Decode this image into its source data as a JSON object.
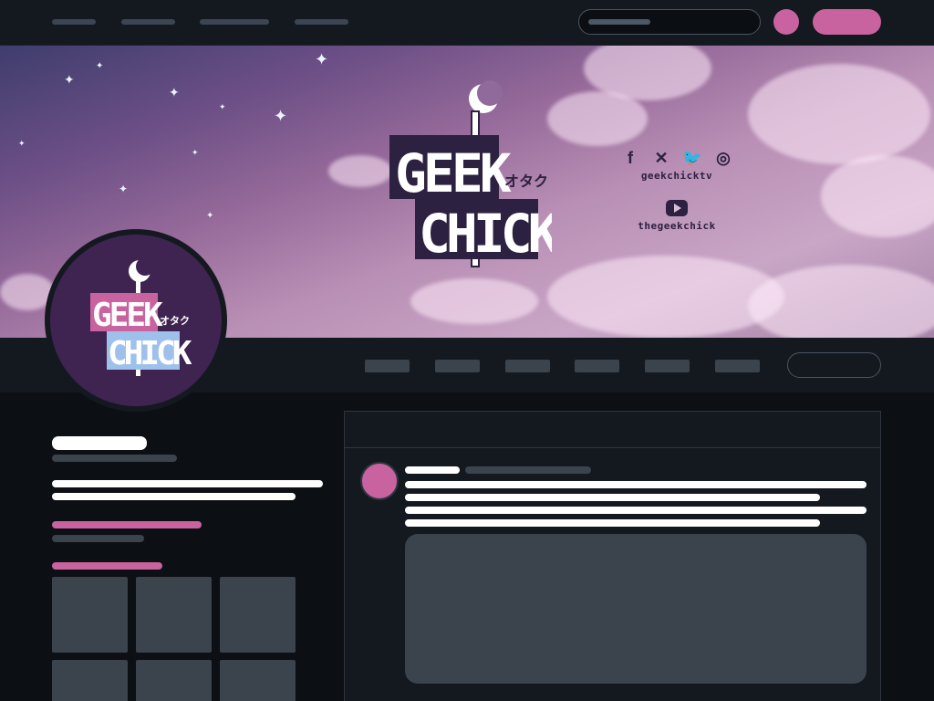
{
  "brand": {
    "logo_text_line1": "GEEK",
    "logo_text_line2": "CHICK",
    "logo_katakana": "オタク",
    "accent_color": "#c9639f",
    "dark_purple": "#3f2452"
  },
  "banner": {
    "social_icons": [
      "facebook-icon",
      "x-icon",
      "twitter-icon",
      "instagram-icon"
    ],
    "social_handle": "geekchicktv",
    "youtube_icon": "youtube-icon",
    "youtube_handle": "thegeekchick"
  },
  "header": {
    "search": {
      "placeholder": ""
    }
  }
}
